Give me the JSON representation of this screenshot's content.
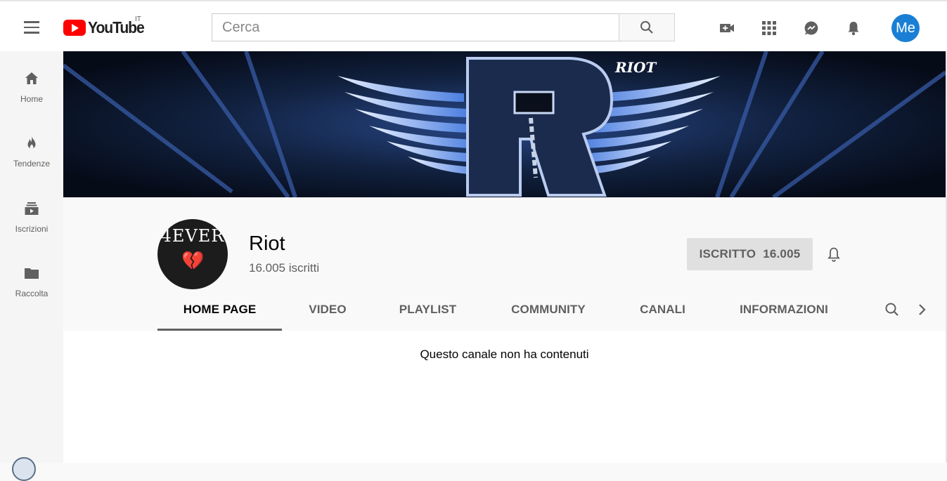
{
  "header": {
    "logo_text": "YouTube",
    "country_code": "IT",
    "search_placeholder": "Cerca",
    "search_value": "",
    "icons": [
      "upload-video-icon",
      "apps-grid-icon",
      "messages-icon",
      "notifications-bell-icon"
    ],
    "avatar_label": "Me",
    "avatar_color": "#1a7fd4",
    "brand_color": "#ff0000"
  },
  "sidebar": {
    "items": [
      {
        "label": "Home",
        "icon": "home-icon"
      },
      {
        "label": "Tendenze",
        "icon": "flame-icon"
      },
      {
        "label": "Iscrizioni",
        "icon": "subscriptions-icon"
      },
      {
        "label": "Raccolta",
        "icon": "folder-icon"
      }
    ]
  },
  "banner": {
    "brand_text": "RIOT"
  },
  "channel": {
    "name": "Riot",
    "subscribers_text": "16.005 iscritti",
    "avatar_text": "4EVER",
    "subscribe_button": {
      "label": "ISCRITTO",
      "count": "16.005"
    }
  },
  "tabs": [
    {
      "label": "HOME PAGE",
      "active": true
    },
    {
      "label": "VIDEO",
      "active": false
    },
    {
      "label": "PLAYLIST",
      "active": false
    },
    {
      "label": "COMMUNITY",
      "active": false
    },
    {
      "label": "CANALI",
      "active": false
    },
    {
      "label": "INFORMAZIONI",
      "active": false
    }
  ],
  "content": {
    "empty_message": "Questo canale non ha contenuti"
  }
}
